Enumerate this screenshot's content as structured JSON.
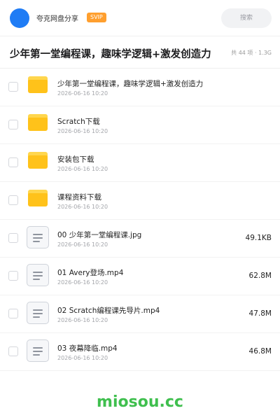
{
  "header": {
    "share_name": "夸克网盘分享",
    "badge": "SVIP",
    "search_label": "搜索"
  },
  "title_bar": {
    "title": "少年第一堂编程课，趣味学逻辑+激发创造力",
    "meta": "共 44 项 · 1.3G"
  },
  "files": [
    {
      "type": "folder",
      "name": "少年第一堂编程课，趣味学逻辑+激发创造力",
      "date": "2026-06-16 10:20",
      "size": ""
    },
    {
      "type": "folder",
      "name": "Scratch下载",
      "date": "2026-06-16 10:20",
      "size": ""
    },
    {
      "type": "folder",
      "name": "安装包下载",
      "date": "2026-06-16 10:20",
      "size": ""
    },
    {
      "type": "folder",
      "name": "课程资料下载",
      "date": "2026-06-16 10:20",
      "size": ""
    },
    {
      "type": "file",
      "name": "00 少年第一堂编程课.jpg",
      "date": "2026-06-16 10:20",
      "size": "49.1KB"
    },
    {
      "type": "file",
      "name": "01 Avery登场.mp4",
      "date": "2026-06-16 10:20",
      "size": "62.8M"
    },
    {
      "type": "file",
      "name": "02 Scratch编程课先导片.mp4",
      "date": "2026-06-16 10:20",
      "size": "47.8M"
    },
    {
      "type": "file",
      "name": "03 夜幕降临.mp4",
      "date": "2026-06-16 10:20",
      "size": "46.8M"
    }
  ],
  "watermark": "miosou.cc",
  "colors": {
    "accent_blue": "#1f7cf5",
    "svip_orange": "#ff9f2e",
    "folder_yellow": "#ffc21a",
    "watermark_green": "#3fbf4e"
  }
}
